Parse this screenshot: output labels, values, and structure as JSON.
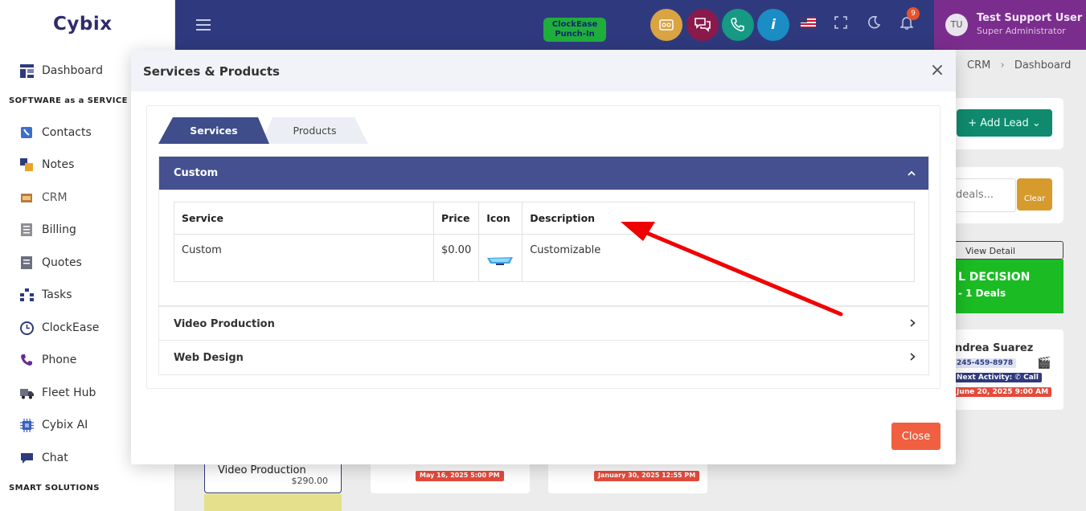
{
  "sidebar": {
    "logo": "Cybix",
    "dashboard": "Dashboard",
    "section_saas": "SOFTWARE as a SERVICE",
    "items": [
      {
        "label": "Contacts"
      },
      {
        "label": "Notes"
      },
      {
        "label": "CRM"
      },
      {
        "label": "Billing"
      },
      {
        "label": "Quotes"
      },
      {
        "label": "Tasks"
      },
      {
        "label": "ClockEase"
      },
      {
        "label": "Phone"
      },
      {
        "label": "Fleet Hub"
      },
      {
        "label": "Cybix AI"
      },
      {
        "label": "Chat"
      }
    ],
    "section_smart": "SMART SOLUTIONS"
  },
  "topbar": {
    "punch_line1": "ClockEase",
    "punch_line2": "Punch-In",
    "notification_count": "9",
    "user_initials": "TU",
    "user_name": "Test Support User",
    "user_role": "Super Administrator"
  },
  "background": {
    "breadcrumb_1": "CRM",
    "breadcrumb_sep": "›",
    "breadcrumb_2": "Dashboard",
    "add_lead": "+ Add Lead ⌄",
    "search_fragment": "deals...",
    "clear": "Clear",
    "view_detail": "View Detail",
    "decision_title": "L DECISION",
    "decision_sub": "- 1 Deals",
    "lead_name": "ndrea Suarez",
    "lead_phone": "245-459-8978",
    "next_activity": "Next Activity: ✆ Call",
    "lead_date": "June 20, 2025 9:00 AM",
    "card1_title": "Video Production",
    "card1_price": "$290.00",
    "card2_date": "May 16, 2025 5:00 PM",
    "card3_date": "January 30, 2025 12:55 PM"
  },
  "modal": {
    "title": "Services & Products",
    "tabs": [
      {
        "label": "Services"
      },
      {
        "label": "Products"
      }
    ],
    "accordion_active": "Custom",
    "table_headers": {
      "service": "Service",
      "price": "Price",
      "icon": "Icon",
      "description": "Description"
    },
    "table_rows": [
      {
        "service": "Custom",
        "price": "$0.00",
        "description": "Customizable"
      }
    ],
    "accordion_items": [
      {
        "label": "Video Production"
      },
      {
        "label": "Web Design"
      }
    ],
    "close_label": "Close"
  },
  "colors": {
    "topbar": "#2f3a7e",
    "accordion_active": "#44508f",
    "close_button": "#ef5f40",
    "annotation_arrow": "#f00000"
  }
}
